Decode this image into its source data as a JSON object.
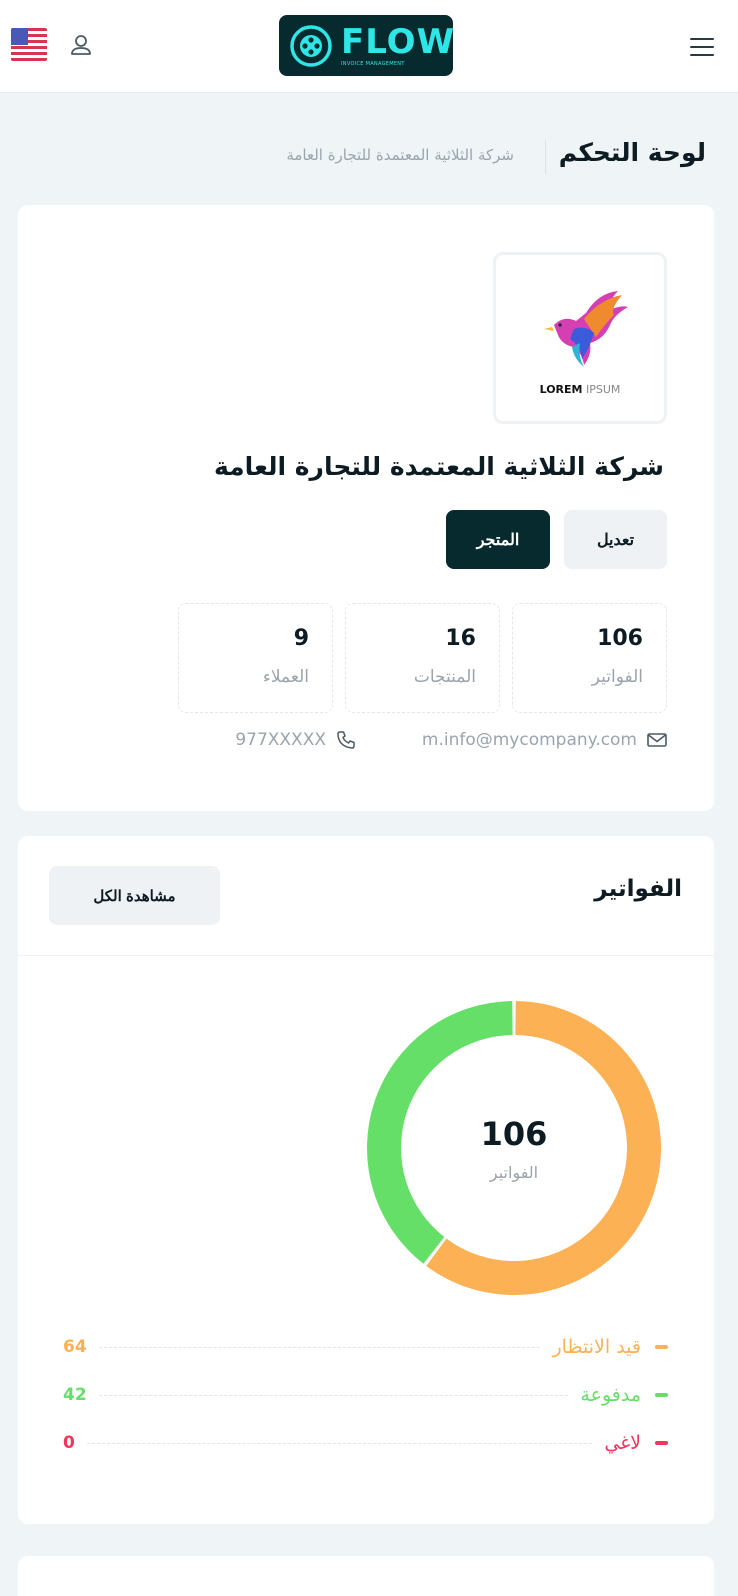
{
  "header": {
    "logo_text": "FLOW",
    "logo_subtitle": "INVOICE MANAGEMENT",
    "menu_icon": "hamburger-menu-icon",
    "user_icon": "user-icon",
    "language_flag": "us-flag-icon"
  },
  "page": {
    "title": "لوحة التحكم",
    "subtitle": "شركة الثلاثية المعتمدة للتجارة العامة"
  },
  "profile": {
    "logo_word_bold": "LOREM",
    "logo_word_light": "IPSUM",
    "company_name": "شركة الثلاثية المعتمدة للتجارة العامة",
    "edit_label": "تعديل",
    "store_label": "المتجر",
    "stats": [
      {
        "value": "106",
        "label": "الفواتير"
      },
      {
        "value": "16",
        "label": "المنتجات"
      },
      {
        "value": "9",
        "label": "العملاء"
      }
    ],
    "email": "m.info@mycompany.com",
    "phone": "977XXXXX"
  },
  "invoices": {
    "title": "الفواتير",
    "view_all_label": "مشاهدة الكل",
    "total": "106",
    "total_label": "الفواتير",
    "legend": [
      {
        "label": "قيد الانتظار",
        "value": "64",
        "color": "#fcb155"
      },
      {
        "label": "مدفوعة",
        "value": "42",
        "color": "#66df69"
      },
      {
        "label": "لاغي",
        "value": "0",
        "color": "#f5345c"
      }
    ]
  },
  "colors": {
    "brand_dark": "#072a2e",
    "brand_cyan": "#2ee6e6",
    "pending": "#fcb155",
    "paid": "#66df69",
    "cancelled": "#f5345c"
  }
}
